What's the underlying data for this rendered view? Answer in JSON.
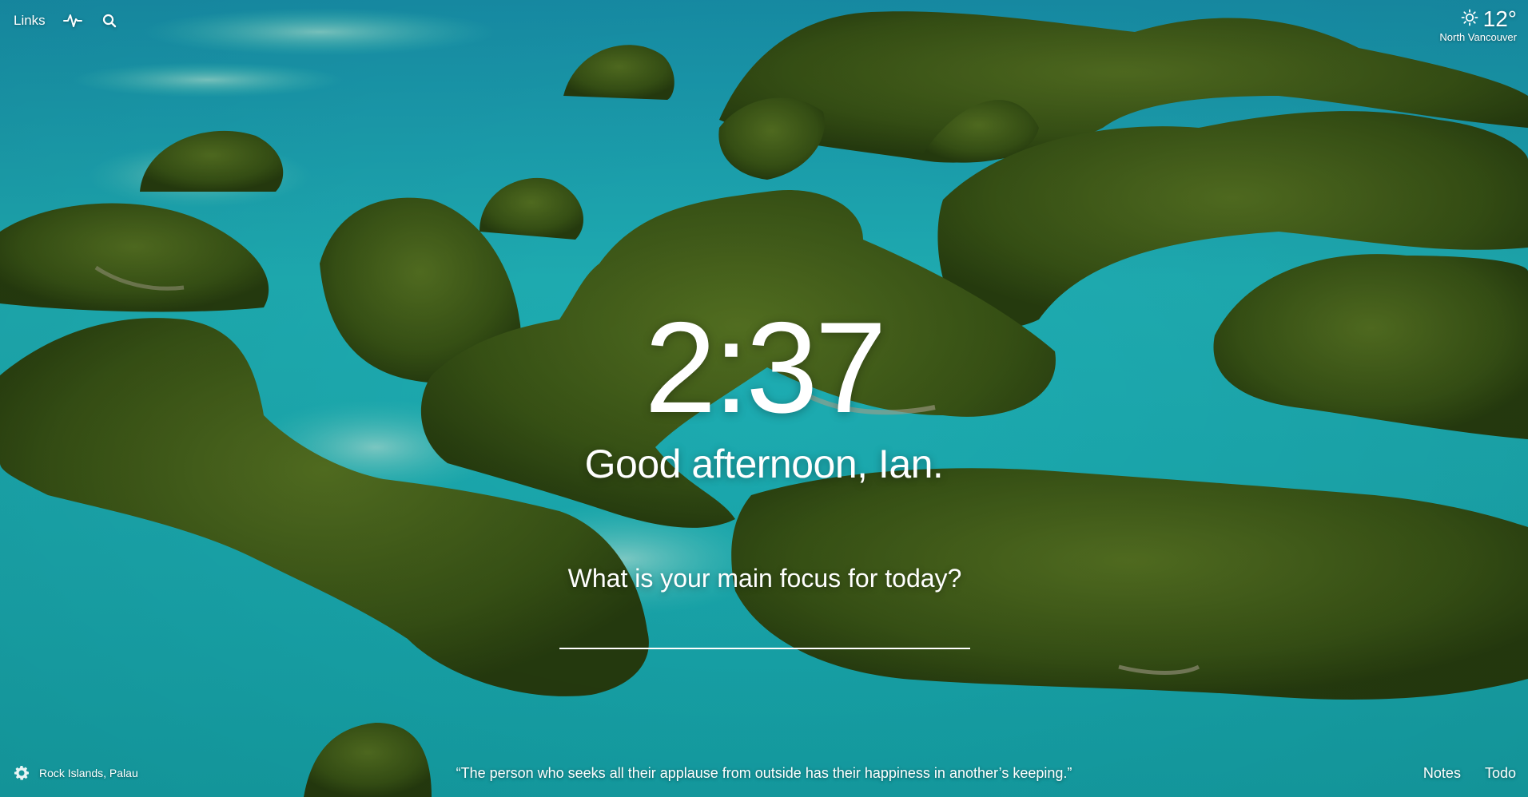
{
  "topbar": {
    "links_label": "Links",
    "icons": [
      "activity-icon",
      "search-icon"
    ]
  },
  "weather": {
    "icon": "sun-icon",
    "temperature": "12°",
    "location": "North Vancouver"
  },
  "clock": {
    "time": "2:37"
  },
  "greeting": {
    "text": "Good afternoon, Ian."
  },
  "focus": {
    "prompt": "What is your main focus for today?",
    "value": ""
  },
  "footer": {
    "settings_icon": "gear-icon",
    "photo_location": "Rock Islands, Palau",
    "quote": "“The person who seeks all their applause from outside has their happiness in another’s keeping.”",
    "notes_label": "Notes",
    "todo_label": "Todo"
  }
}
